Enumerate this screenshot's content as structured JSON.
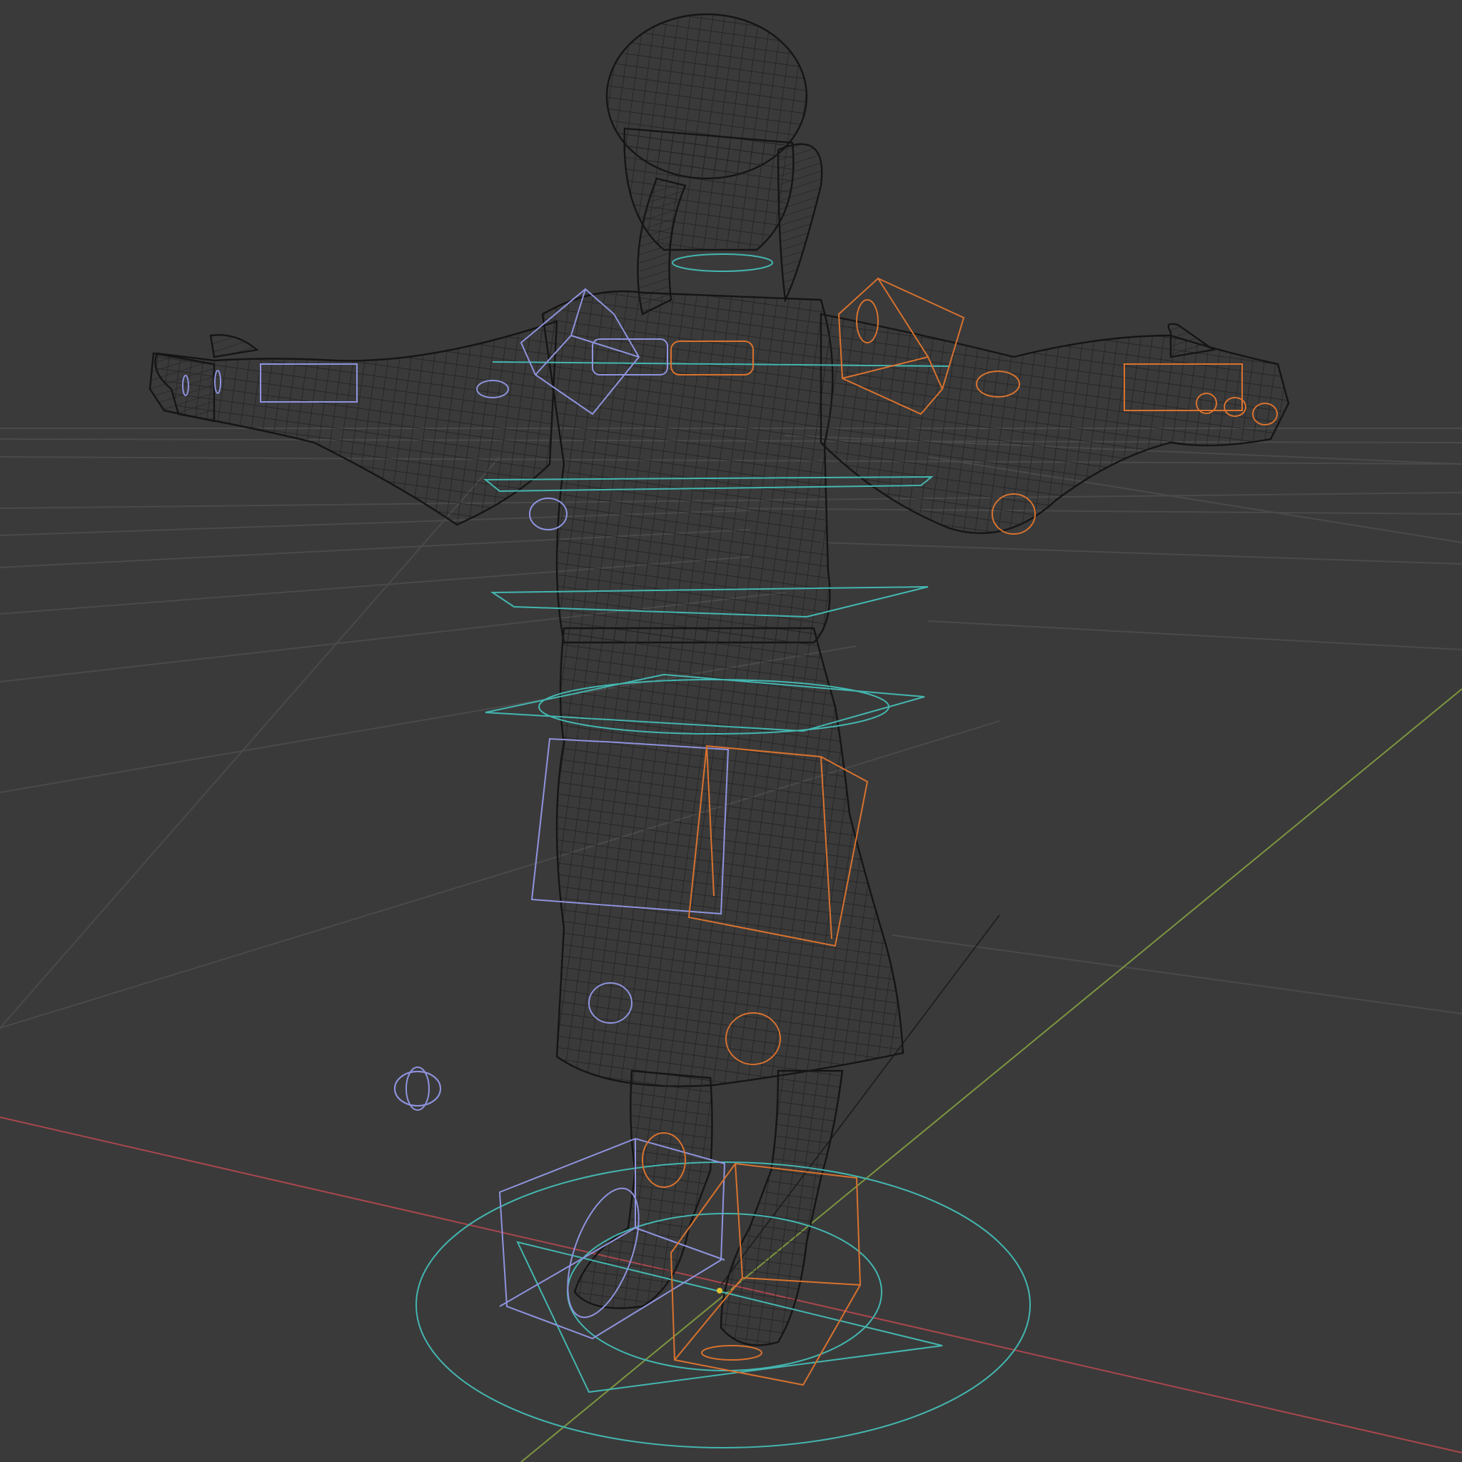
{
  "viewport": {
    "mode": "wireframe",
    "colors": {
      "background": "#3a3a3a",
      "grid": "#4a4a4a",
      "x_axis": "#a8474d",
      "y_axis": "#7d9640",
      "z_axis": "#1a1a1a",
      "mesh_wire": "#111111",
      "rig_center": "#44b6b0",
      "rig_left": "#8f93dd",
      "rig_right": "#d8722f",
      "origin": "#e0c030"
    },
    "objects": [
      {
        "name": "character-mesh",
        "type": "mesh"
      },
      {
        "name": "armature",
        "type": "rig"
      },
      {
        "name": "ground-grid",
        "type": "grid"
      }
    ]
  }
}
